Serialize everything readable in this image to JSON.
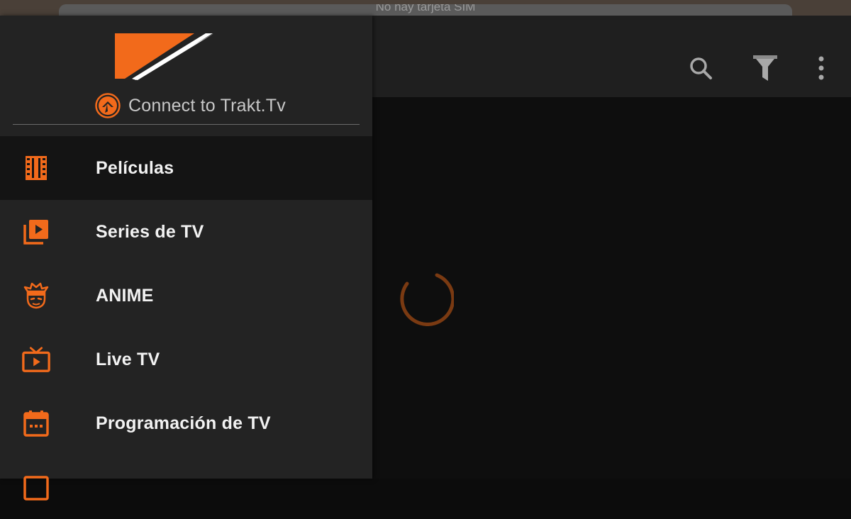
{
  "status": {
    "sim_text": "No hay tarjeta SIM"
  },
  "drawer": {
    "trakt_label": "Connect to Trakt.Tv",
    "items": [
      {
        "label": "Películas",
        "icon": "film-icon",
        "active": true
      },
      {
        "label": "Series de TV",
        "icon": "video-library-icon",
        "active": false
      },
      {
        "label": "ANIME",
        "icon": "anime-face-icon",
        "active": false
      },
      {
        "label": "Live TV",
        "icon": "tv-icon",
        "active": false
      },
      {
        "label": "Programación de TV",
        "icon": "calendar-icon",
        "active": false
      }
    ]
  },
  "app_bar": {
    "actions": [
      "search-icon",
      "filter-icon",
      "more-vert-icon"
    ]
  },
  "colors": {
    "accent": "#f26a1b",
    "drawer_bg": "#232323",
    "active_item_bg": "#141414",
    "text": "#f2f2f2"
  }
}
